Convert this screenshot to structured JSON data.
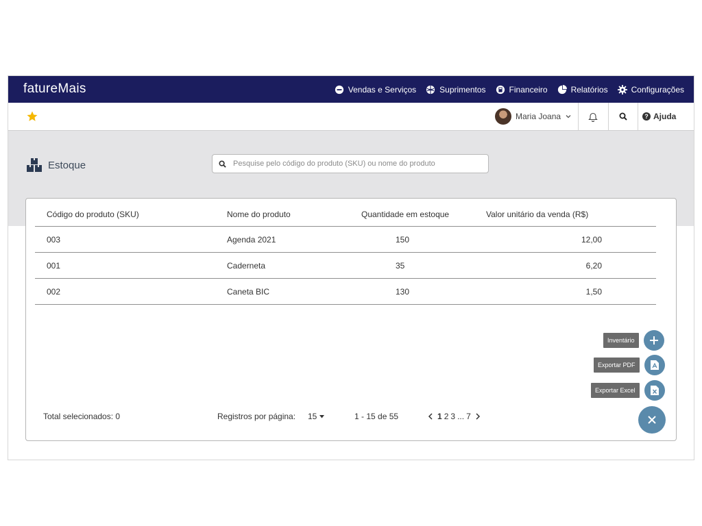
{
  "brand": {
    "logo": "fatureMais"
  },
  "nav": [
    {
      "label": "Vendas e Serviços",
      "icon": "minus-circle-icon"
    },
    {
      "label": "Suprimentos",
      "icon": "basketball-icon"
    },
    {
      "label": "Financeiro",
      "icon": "calculator-icon"
    },
    {
      "label": "Relatórios",
      "icon": "pie-chart-icon"
    },
    {
      "label": "Configurações",
      "icon": "gear-icon"
    }
  ],
  "user": {
    "name": "Maria Joana"
  },
  "help": {
    "label": "Ajuda"
  },
  "page": {
    "title": "Estoque"
  },
  "search": {
    "placeholder": "Pesquise pelo código do produto (SKU) ou nome do produto"
  },
  "table": {
    "headers": [
      "Código do produto (SKU)",
      "Nome do produto",
      "Quantidade em estoque",
      "Valor unitário da venda (R$)"
    ],
    "rows": [
      [
        "003",
        "Agenda 2021",
        "150",
        "12,00"
      ],
      [
        "001",
        "Caderneta",
        "35",
        "6,20"
      ],
      [
        "002",
        "Caneta BIC",
        "130",
        "1,50"
      ]
    ]
  },
  "actions": {
    "inventario": "Inventário",
    "export_pdf": "Exportar PDF",
    "export_excel": "Exportar Excel"
  },
  "footer": {
    "total_selected": "Total selecionados: 0",
    "per_page_label": "Registros por página:",
    "per_page_value": "15",
    "range": "1 - 15 de 55",
    "pages": [
      "1",
      "2",
      "3",
      "...",
      "7"
    ]
  },
  "colors": {
    "topbar": "#1b1d5e",
    "accent_fab": "#5a8aab",
    "star": "#f5b700"
  }
}
